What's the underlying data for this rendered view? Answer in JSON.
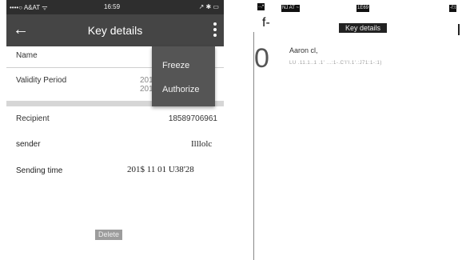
{
  "status_bar": {
    "carrier": "••••○ A&AT ᯤ",
    "time": "16:59",
    "indicators": "↗ ✱ ▭"
  },
  "header": {
    "back_icon": "←",
    "title": "Key details",
    "more_icon": "⋮"
  },
  "details": {
    "name_label": "Name",
    "validity_label": "Validity Period",
    "validity_line1": "201",
    "validity_line2": "201",
    "recipient_label": "Recipient",
    "recipient_value": "18589706961"
  },
  "menu": {
    "freeze": "Freeze",
    "authorize": "Authorize"
  },
  "lower": {
    "sender_label": "sender",
    "sender_value": "Illlolc",
    "sending_time_label": "Sending time",
    "sending_time_value": "201$ 11 01 U38'28",
    "delete_label": "Delete"
  },
  "right_panel": {
    "status_left": "..,•",
    "status_carrier": "NJ AT ~",
    "status_time": "1E69",
    "status_right": "-f:t",
    "back_glyph": "f-",
    "title": "Key details",
    "avatar_glyph": "0",
    "name": "Aaron cl,",
    "subtitle": "LU .11.1..1 .1' ...:1-.C'I'l.1'.:J71:1-:1)"
  }
}
